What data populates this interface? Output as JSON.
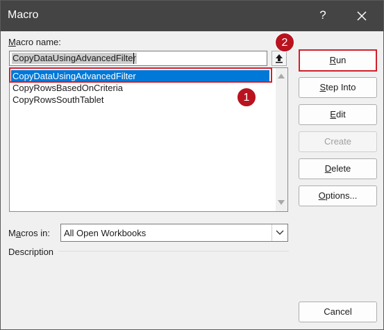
{
  "window": {
    "title": "Macro",
    "help_glyph": "?",
    "close_icon": "close-icon"
  },
  "macro_name": {
    "label_mnemonic": "M",
    "label_rest": "acro name:",
    "value": "CopyDataUsingAdvancedFilter"
  },
  "macro_list": {
    "items": [
      {
        "label": "CopyDataUsingAdvancedFilter",
        "selected": true
      },
      {
        "label": "CopyRowsBasedOnCriteria",
        "selected": false
      },
      {
        "label": "CopyRowsSouthTablet",
        "selected": false
      }
    ]
  },
  "buttons": {
    "run": {
      "mnemonic": "R",
      "rest": "un"
    },
    "step_into": {
      "mnemonic": "S",
      "rest": "tep Into"
    },
    "edit": {
      "mnemonic": "E",
      "rest": "dit"
    },
    "create": {
      "label": "Create"
    },
    "delete": {
      "mnemonic": "D",
      "rest": "elete"
    },
    "options": {
      "mnemonic": "O",
      "rest": "ptions..."
    },
    "cancel": {
      "label": "Cancel"
    }
  },
  "macros_in": {
    "label_prefix": "M",
    "label_mnemonic": "a",
    "label_rest": "cros in:",
    "value": "All Open Workbooks"
  },
  "description": {
    "label": "Description"
  },
  "annotations": {
    "badge_1": "1",
    "badge_2": "2",
    "accent_color": "#d0202d",
    "badge_color": "#b8131f"
  },
  "colors": {
    "titlebar": "#444444",
    "selection": "#0078d7",
    "dialog_bg": "#f0f0f0"
  }
}
